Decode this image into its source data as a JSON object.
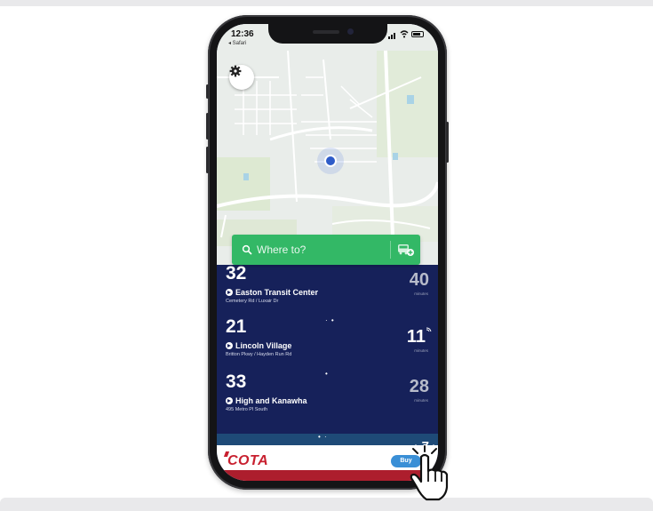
{
  "status_bar": {
    "time": "12:36",
    "back_app": "◂ Safari"
  },
  "map": {
    "settings_icon": "gear-icon"
  },
  "search": {
    "placeholder": "Where to?",
    "icon": "search-icon",
    "action_icon": "bus-add-icon"
  },
  "routes": [
    {
      "number": "32",
      "destination": "Easton Transit Center",
      "stop": "Cemetery Rd / Luxair Dr",
      "minutes": "40",
      "minutes_label": "minutes",
      "realtime": false
    },
    {
      "number": "21",
      "destination": "Lincoln Village",
      "stop": "Britton Pkwy / Hayden Run Rd",
      "minutes": "11",
      "minutes_label": "minutes",
      "realtime": true
    },
    {
      "number": "33",
      "destination": "High and Kanawha",
      "stop": "495 Metro Pl South",
      "minutes": "28",
      "minutes_label": "minutes",
      "realtime": false
    }
  ],
  "partial_route": {
    "minutes": "7"
  },
  "ad": {
    "brand": "COTA",
    "buy_label": "Buy"
  },
  "colors": {
    "routes_background": "#16215a",
    "search_green": "#33b866",
    "cota_red": "#c8202f",
    "buy_blue": "#3a8fd6"
  }
}
